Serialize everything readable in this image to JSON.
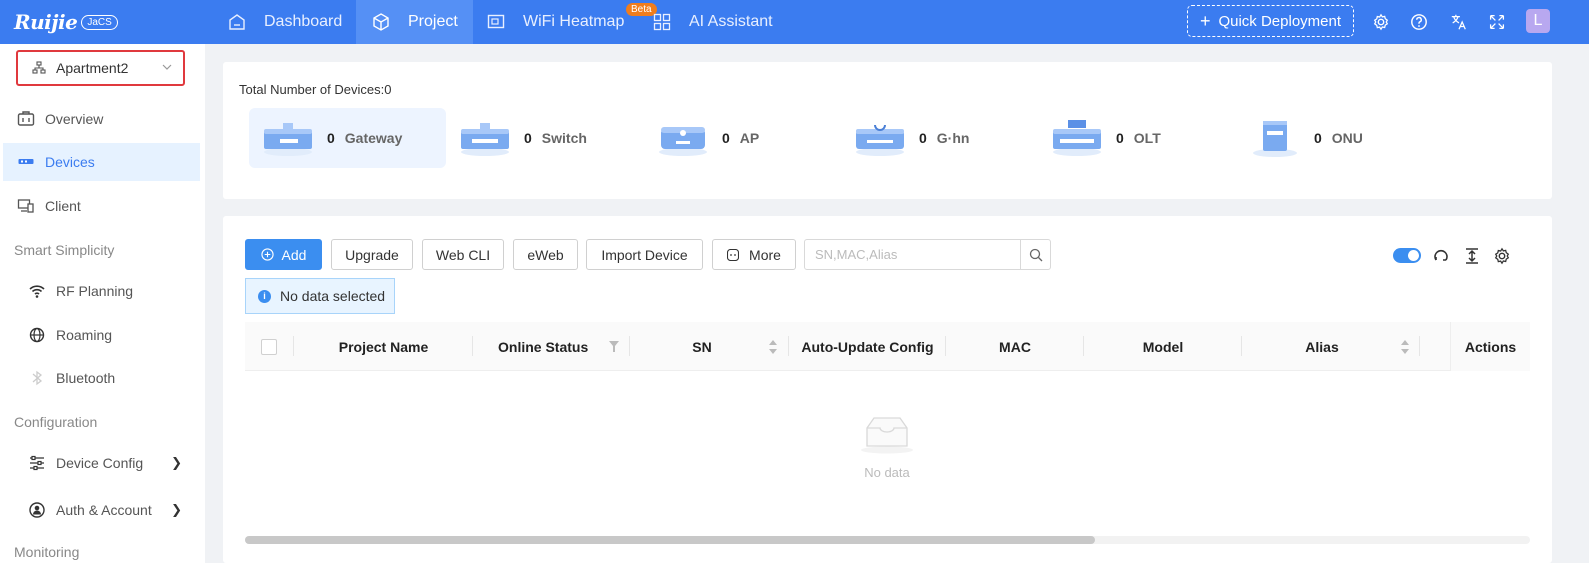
{
  "topbar": {
    "logo": "Ruijie",
    "logo_badge": "JaCS",
    "nav": [
      {
        "label": "Dashboard",
        "icon": "home-icon"
      },
      {
        "label": "Project",
        "icon": "cube-icon",
        "active": true
      },
      {
        "label": "WiFi Heatmap",
        "icon": "heatmap-icon",
        "badge": "Beta"
      },
      {
        "label": "AI Assistant",
        "icon": "grid-icon"
      }
    ],
    "quick_deployment": "Quick Deployment",
    "avatar_letter": "L"
  },
  "sidebar": {
    "project": "Apartment2",
    "items": [
      {
        "label": "Overview",
        "icon": "overview-icon"
      },
      {
        "label": "Devices",
        "icon": "devices-icon",
        "active": true
      },
      {
        "label": "Client",
        "icon": "client-icon"
      }
    ],
    "groups": {
      "smart": "Smart Simplicity",
      "config": "Configuration",
      "monitoring": "Monitoring"
    },
    "smart_items": [
      {
        "label": "RF Planning",
        "icon": "wifi-icon"
      },
      {
        "label": "Roaming",
        "icon": "globe-icon"
      },
      {
        "label": "Bluetooth",
        "icon": "bluetooth-icon"
      }
    ],
    "config_items": [
      {
        "label": "Device Config",
        "icon": "sliders-icon"
      },
      {
        "label": "Auth & Account",
        "icon": "user-icon"
      }
    ]
  },
  "summary": {
    "title": "Total Number of Devices:0",
    "devices": [
      {
        "count": "0",
        "name": "Gateway"
      },
      {
        "count": "0",
        "name": "Switch"
      },
      {
        "count": "0",
        "name": "AP"
      },
      {
        "count": "0",
        "name": "G·hn"
      },
      {
        "count": "0",
        "name": "OLT"
      },
      {
        "count": "0",
        "name": "ONU"
      }
    ]
  },
  "toolbar": {
    "add": "Add",
    "upgrade": "Upgrade",
    "webcli": "Web CLI",
    "eweb": "eWeb",
    "import": "Import Device",
    "more": "More",
    "search_placeholder": "SN,MAC,Alias"
  },
  "notice": "No data selected",
  "table": {
    "columns": [
      "Project Name",
      "Online Status",
      "SN",
      "Auto-Update Config",
      "MAC",
      "Model",
      "Alias"
    ],
    "actions": "Actions",
    "empty": "No data"
  },
  "colors": {
    "primary": "#3b7cf0",
    "accent": "#3b8ef0",
    "beta": "#f07d1d",
    "highlight_border": "#e0393e"
  }
}
